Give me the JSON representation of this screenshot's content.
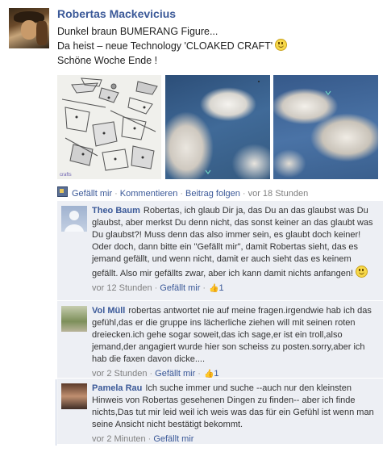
{
  "post": {
    "author": "Robertas Mackevicius",
    "message_lines": [
      "Dunkel braun BUMERANG Figure...",
      "Da heist – neue Technology 'CLOAKED CRAFT'",
      "Schöne Woche Ende !"
    ],
    "photo_caption": "crafts"
  },
  "actions": {
    "like": "Gefällt mir",
    "comment": "Kommentieren",
    "follow": "Beitrag folgen",
    "time": "vor 18 Stunden",
    "separator": "·"
  },
  "comments": [
    {
      "name": "Theo Baum",
      "text": "Robertas, ich glaub Dir ja, das Du an das glaubst was Du glaubst, aber merkst Du denn nicht, das sonst keiner an das glaubt was Du glaubst?! Muss denn das also immer sein, es glaubt doch keiner! Oder doch, dann bitte ein \"Gefällt mir\", damit Robertas sieht, das es jemand gefällt, und wenn nicht, damit er auch sieht das es keinem gefällt. Also mir gefällts zwar, aber ich kann damit nichts anfangen!",
      "time": "vor 12 Stunden",
      "like": "Gefällt mir",
      "likes": "1"
    },
    {
      "name": "Vol Müll",
      "text": "robertas antwortet nie auf meine fragen.irgendwie hab ich das gefühl,das er die gruppe ins lächerliche ziehen will mit seinen roten dreiecken.ich gehe sogar soweit,das ich sage,er ist ein troll,also jemand,der angagiert wurde hier son scheiss zu posten.sorry,aber ich hab die faxen davon dicke....",
      "time": "vor 2 Stunden",
      "like": "Gefällt mir",
      "likes": "1"
    },
    {
      "name": "Pamela Rau",
      "text": "Ich suche immer und suche --auch nur den kleinsten Hinweis von Robertas gesehenen Dingen zu finden-- aber ich finde nichts,Das tut mir leid weil ich weis was das für ein Gefühl ist wenn man seine Ansicht nicht bestätigt bekommt.",
      "time": "vor 2 Minuten",
      "like": "Gefällt mir"
    }
  ],
  "icons": {
    "smiley": "smiley-icon",
    "like": "like-page-icon",
    "thumb": "thumbs-up-icon"
  },
  "colors": {
    "link": "#3b5998",
    "comment_bg": "#edeff4",
    "muted": "#808080"
  }
}
